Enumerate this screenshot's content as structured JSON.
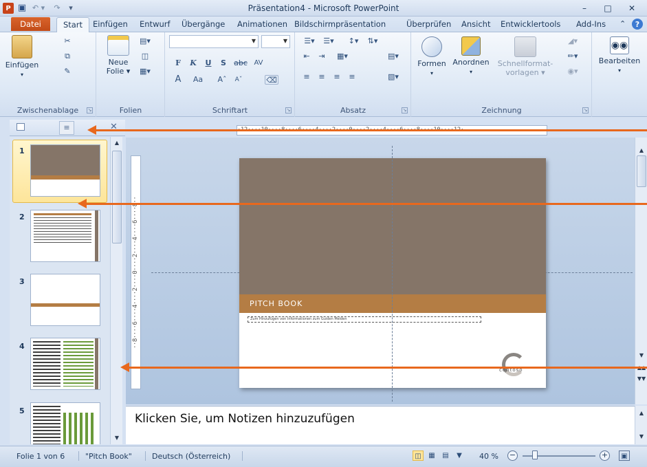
{
  "window": {
    "app_icon": "P",
    "title": "Präsentation4  -  Microsoft PowerPoint",
    "minimize": "–",
    "maximize": "□",
    "close": "✕"
  },
  "qat": {
    "save": "💾",
    "undo": "↶ ▾",
    "redo": "↷",
    "more": "│▾"
  },
  "tabs": {
    "datei": "Datei",
    "items": [
      "Start",
      "Einfügen",
      "Entwurf",
      "Übergänge",
      "Animationen",
      "Bildschirmpräsentation",
      "Überprüfen",
      "Ansicht",
      "Entwicklertools",
      "Add-Ins"
    ],
    "active": "Start"
  },
  "ribbon": {
    "groups": {
      "clipboard": "Zwischenablage",
      "slides": "Folien",
      "font": "Schriftart",
      "paragraph": "Absatz",
      "drawing": "Zeichnung"
    },
    "buttons": {
      "paste": "Einfügen",
      "new_slide_1": "Neue",
      "new_slide_2": "Folie ▾",
      "font_bold": "F",
      "font_italic": "K",
      "font_underline": "U",
      "font_shadow": "S",
      "font_strike": "abc",
      "font_spacing": "AV",
      "font_grow": "Aˆ",
      "font_shrink": "Aˇ",
      "font_color": "A",
      "font_case": "Aa",
      "shapes": "Formen",
      "arrange": "Anordnen",
      "quick_styles_1": "Schnellformat-",
      "quick_styles_2": "vorlagen ▾",
      "edit": "Bearbeiten"
    }
  },
  "slides_panel": {
    "close": "✕",
    "outline_icon": "≡",
    "thumbnails": [
      {
        "number": "1"
      },
      {
        "number": "2"
      },
      {
        "number": "3"
      },
      {
        "number": "4"
      },
      {
        "number": "5"
      }
    ]
  },
  "rulers": {
    "horizontal": "·12····10····8····6····4····2····0····2····4····6····8····10····12·",
    "vertical": "··8····6····4····2····0····2····4····6····8··"
  },
  "slide": {
    "title": "PITCH BOOK",
    "subtitle": "Zum Hinzufügen von Informationen zum Guiden Melden",
    "logo": "contoso"
  },
  "notes": {
    "placeholder": "Klicken Sie, um Notizen hinzuzufügen"
  },
  "status": {
    "slide_info": "Folie 1 von 6",
    "theme": "\"Pitch Book\"",
    "language": "Deutsch (Österreich)",
    "zoom": "40 %",
    "zoom_fraction": 0.4
  },
  "annotations": {
    "color": "#e8681d"
  },
  "colors": {
    "slide_top": "#857568",
    "slide_band": "#b47d44",
    "accent": "#c24b18"
  }
}
